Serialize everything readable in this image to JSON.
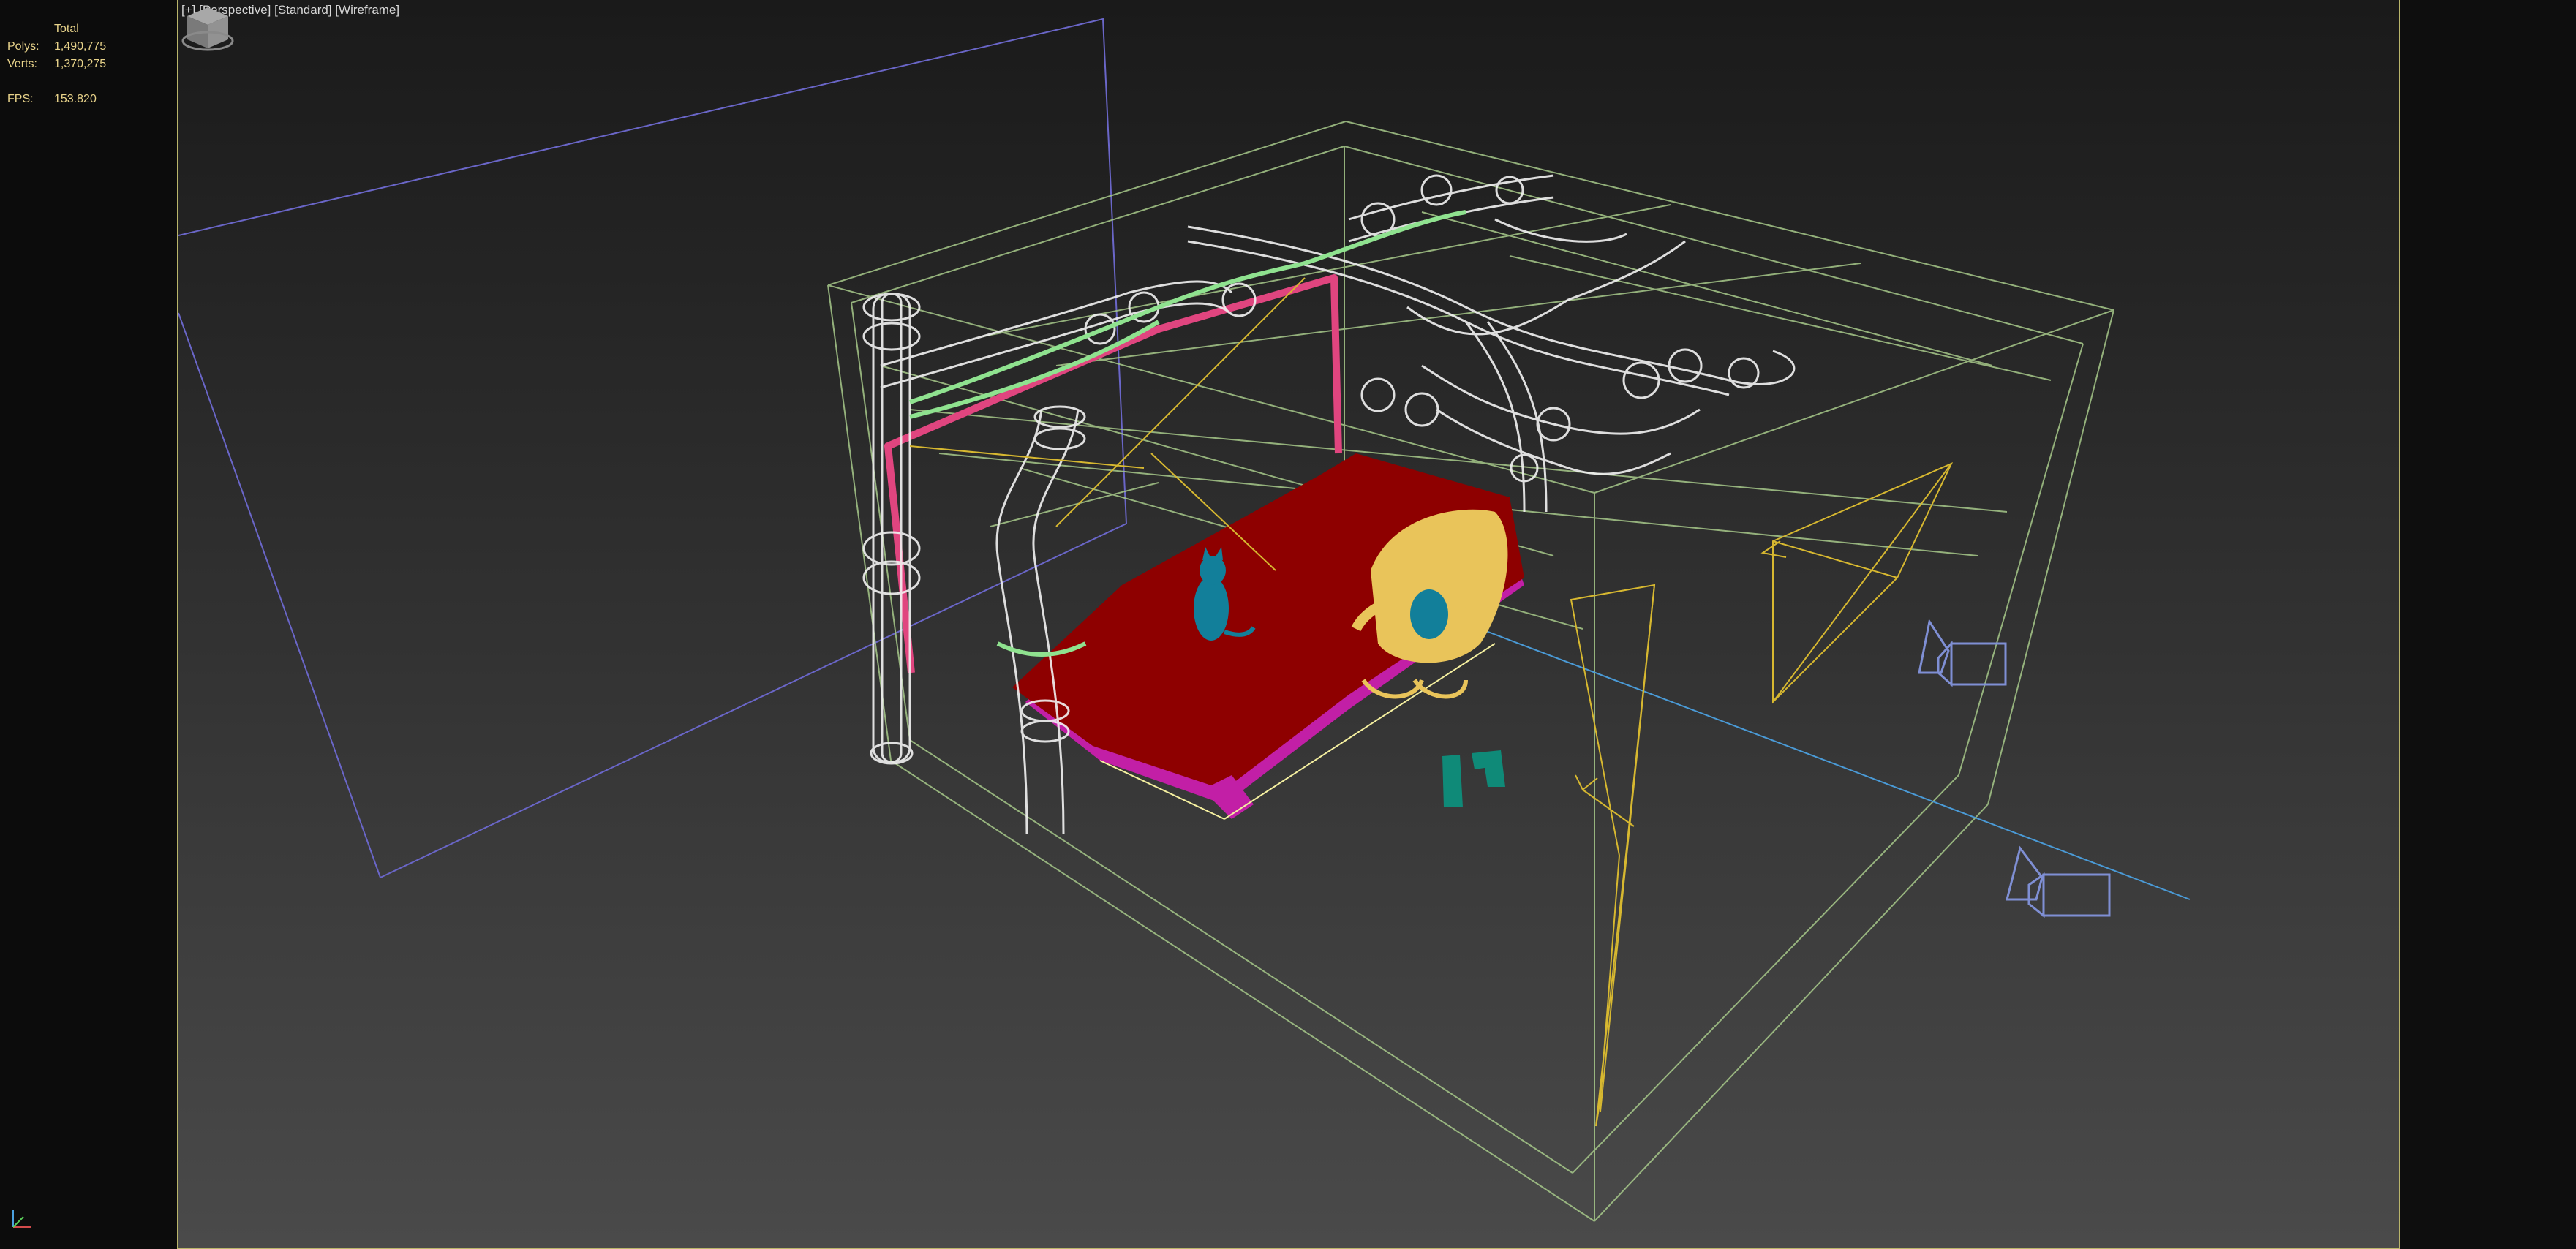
{
  "viewport": {
    "menu_plus": "[+]",
    "view_name": "[Perspective]",
    "shading_style": "[Standard]",
    "render_mode": "[Wireframe]"
  },
  "statistics": {
    "header": "Total",
    "polys_label": "Polys:",
    "polys_value": "1,490,775",
    "verts_label": "Verts:",
    "verts_value": "1,370,275",
    "fps_label": "FPS:",
    "fps_value": "153.820"
  },
  "colors": {
    "viewport_border": "#b9b56a",
    "stats_text": "#e8d38a",
    "box_wire": "#a7c98a",
    "pipe_wire": "#f2f2f2",
    "pipe_green": "#8fe28f",
    "bed_red": "#8e0000",
    "bed_frame_magenta": "#c21fa6",
    "frame_pink": "#e0457f",
    "chair_yellow": "#e9c45a",
    "cat_teal": "#127f9a",
    "bin_teal": "#0f8a78",
    "light_yellow": "#d7b830",
    "camera_blue": "#7f8fd4",
    "plane_purple": "#6a66c8"
  },
  "icons": {
    "axis_gizmo": "xyz-axis-icon",
    "viewcube": "viewcube-icon"
  }
}
